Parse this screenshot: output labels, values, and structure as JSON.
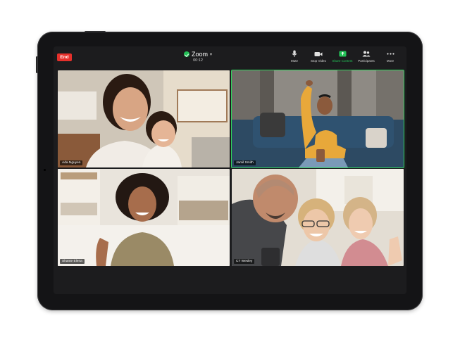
{
  "call": {
    "end_label": "End",
    "app_name": "Zoom",
    "timer": "00:12",
    "secure_color": "#23c257",
    "end_color": "#e5302b"
  },
  "toolbar": {
    "items": [
      {
        "label": "Mute",
        "icon": "microphone-icon"
      },
      {
        "label": "Stop Video",
        "icon": "video-camera-icon"
      },
      {
        "label": "Share Content",
        "icon": "share-screen-icon"
      },
      {
        "label": "Participants",
        "icon": "participants-icon"
      },
      {
        "label": "More",
        "icon": "more-icon"
      }
    ]
  },
  "participants": [
    {
      "name": "Ada Nguyen",
      "active": false
    },
    {
      "name": "Jamil Smith",
      "active": true
    },
    {
      "name": "Shante Elena",
      "active": false
    },
    {
      "name": "CT Wesley",
      "active": false
    }
  ]
}
